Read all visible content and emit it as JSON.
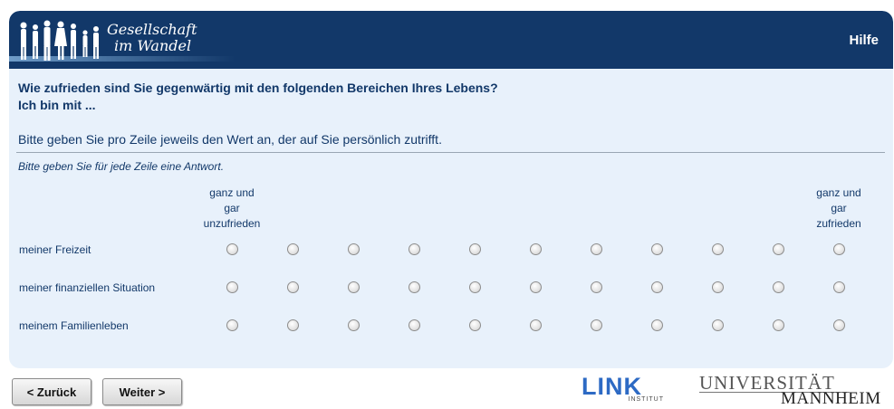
{
  "header": {
    "logo_line1": "Gesellschaft",
    "logo_line2": "im Wandel",
    "help_label": "Hilfe",
    "colors": {
      "header_bg": "#123869",
      "panel_bg": "#e8f1fb",
      "text": "#123869"
    }
  },
  "question": {
    "line1": "Wie zufrieden sind Sie gegenwärtig mit den folgenden Bereichen Ihres Lebens?",
    "line2": "Ich bin mit ...",
    "instruction": "Bitte geben Sie pro Zeile jeweils den Wert an, der auf Sie persönlich zutrifft.",
    "hint": "Bitte geben Sie für jede Zeile eine Antwort."
  },
  "scale": {
    "low_anchor": [
      "ganz und",
      "gar",
      "unzufrieden"
    ],
    "high_anchor": [
      "ganz und",
      "gar",
      "zufrieden"
    ],
    "points": 11
  },
  "rows": [
    {
      "label": "meiner Freizeit",
      "selected": null
    },
    {
      "label": "meiner finanziellen Situation",
      "selected": null
    },
    {
      "label": "meinem Familienleben",
      "selected": null
    }
  ],
  "nav": {
    "back_label": "< Zurück",
    "next_label": "Weiter >"
  },
  "footer": {
    "link_logo": "LINK",
    "link_sub": "INSTITUT",
    "uni_line1": "UNIVERSITÄT",
    "uni_line2": "MANNHEIM"
  }
}
